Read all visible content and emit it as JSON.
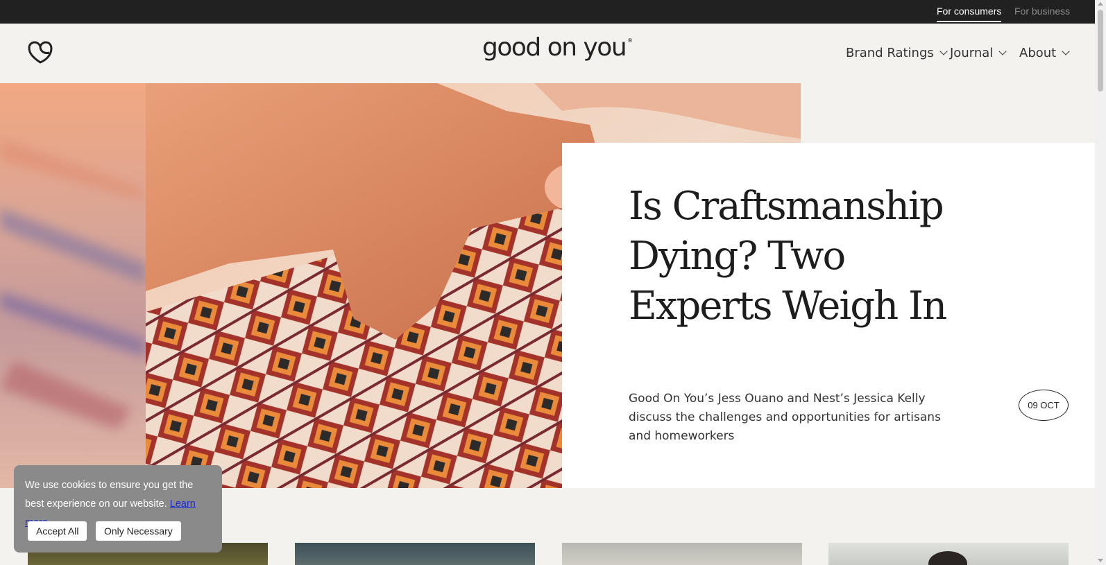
{
  "topbar": {
    "consumers_label": "For consumers",
    "business_label": "For business"
  },
  "header": {
    "brand": "good on you",
    "brand_mark": "®",
    "nav": [
      {
        "label": "Brand Ratings"
      },
      {
        "label": "Journal"
      },
      {
        "label": "About"
      }
    ]
  },
  "hero": {
    "title": "Is Craftsmanship Dying? Two Experts Weigh In",
    "description": "Good On You’s Jess Ouano and Nest’s Jessica Kelly discuss the challenges and opportunities for artisans and homeworkers",
    "date": "09 OCT"
  },
  "cookie": {
    "message": "We use cookies to ensure you get the best experience on our website.",
    "learn_more": "Learn more",
    "accept_all": "Accept All",
    "only_necessary": "Only Necessary"
  },
  "colors": {
    "topbar_bg": "#212121",
    "page_bg": "#f4f2ef",
    "card_bg": "#ffffff",
    "cookie_bg": "#8a8a8a",
    "link": "#1a2bd8"
  }
}
